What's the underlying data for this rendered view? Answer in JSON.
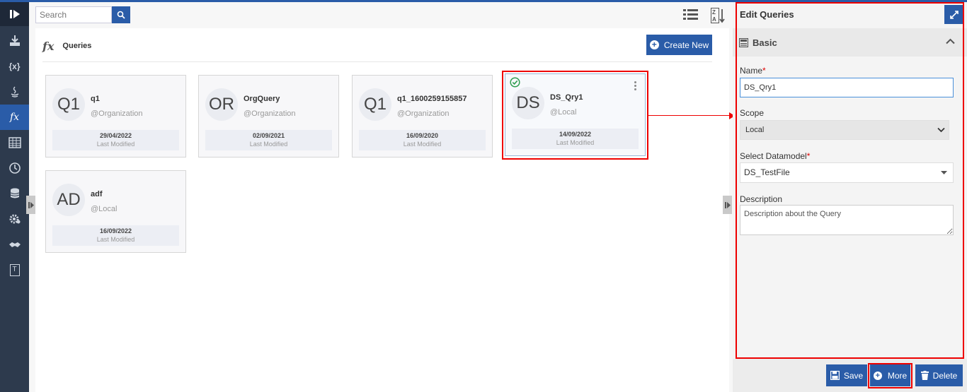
{
  "sidebar": {
    "items": [
      {
        "icon": "download-icon"
      },
      {
        "icon": "variable-braces-icon",
        "label": "{x}"
      },
      {
        "icon": "java-icon"
      },
      {
        "icon": "fx-icon",
        "label": "fx"
      },
      {
        "icon": "table-icon"
      },
      {
        "icon": "clock-circle-icon"
      },
      {
        "icon": "database-icon"
      },
      {
        "icon": "gear-network-icon"
      },
      {
        "icon": "handshake-icon"
      },
      {
        "icon": "text-template-icon",
        "label": "T"
      }
    ]
  },
  "toolbar": {
    "search_placeholder": "Search"
  },
  "queries": {
    "title": "Queries",
    "fx_label": "fx",
    "create_label": "Create New",
    "last_modified_label": "Last Modified",
    "cards": [
      {
        "initials": "Q1",
        "name": "q1",
        "scope": "@Organization",
        "date": "29/04/2022"
      },
      {
        "initials": "OR",
        "name": "OrgQuery",
        "scope": "@Organization",
        "date": "02/09/2021"
      },
      {
        "initials": "Q1",
        "name": "q1_1600259155857",
        "scope": "@Organization",
        "date": "16/09/2020"
      },
      {
        "initials": "DS",
        "name": "DS_Qry1",
        "scope": "@Local",
        "date": "14/09/2022"
      },
      {
        "initials": "AD",
        "name": "adf",
        "scope": "@Local",
        "date": "16/09/2022"
      }
    ]
  },
  "panel": {
    "title": "Edit Queries",
    "section": "Basic",
    "name_label": "Name",
    "name_value": "DS_Qry1",
    "required_mark": "*",
    "scope_label": "Scope",
    "scope_value": "Local",
    "datamodel_label": "Select Datamodel",
    "datamodel_value": "DS_TestFile",
    "description_label": "Description",
    "description_placeholder": "Description about the Query",
    "save_label": "Save",
    "more_label": "More",
    "delete_label": "Delete"
  },
  "colors": {
    "accent": "#2a5ca8",
    "sidebar": "#2d3a4d",
    "highlight": "#ee0000"
  }
}
